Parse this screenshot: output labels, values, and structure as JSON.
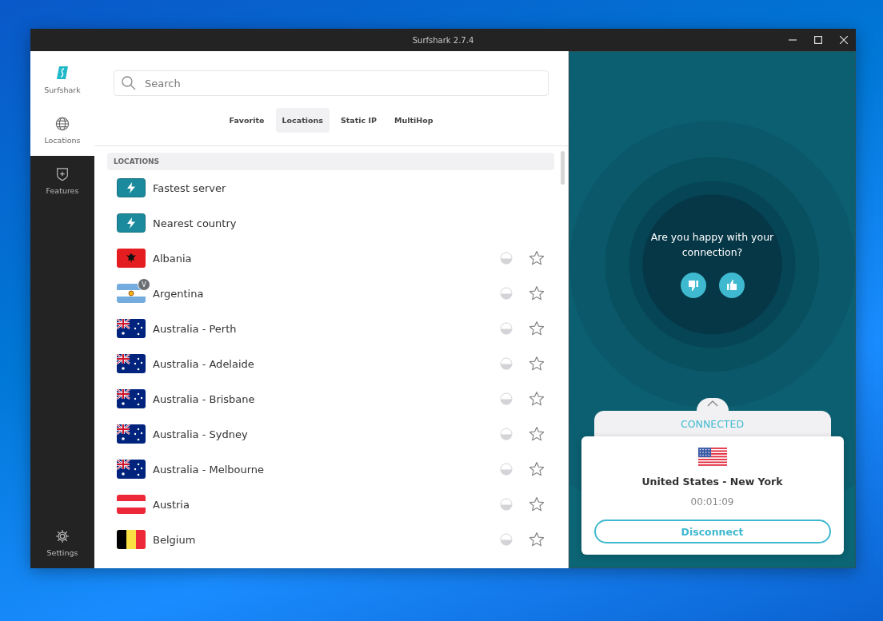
{
  "window": {
    "title": "Surfshark 2.7.4"
  },
  "sidebar": {
    "brand": "Surfshark",
    "items": [
      {
        "label": "Locations",
        "selected": true
      },
      {
        "label": "Features",
        "selected": false
      },
      {
        "label": "Settings",
        "selected": false
      }
    ]
  },
  "search": {
    "placeholder": "Search"
  },
  "tabs": [
    {
      "label": "Favorite",
      "selected": false
    },
    {
      "label": "Locations",
      "selected": true
    },
    {
      "label": "Static IP",
      "selected": false
    },
    {
      "label": "MultiHop",
      "selected": false
    }
  ],
  "section_header": "LOCATIONS",
  "locations": [
    {
      "name": "Fastest server",
      "kind": "quick"
    },
    {
      "name": "Nearest country",
      "kind": "quick"
    },
    {
      "name": "Albania",
      "kind": "country",
      "favorite": false
    },
    {
      "name": "Argentina",
      "kind": "country",
      "badge": "V",
      "favorite": false
    },
    {
      "name": "Australia - Perth",
      "kind": "country",
      "favorite": false
    },
    {
      "name": "Australia - Adelaide",
      "kind": "country",
      "favorite": false
    },
    {
      "name": "Australia - Brisbane",
      "kind": "country",
      "favorite": false
    },
    {
      "name": "Australia - Sydney",
      "kind": "country",
      "favorite": false
    },
    {
      "name": "Australia - Melbourne",
      "kind": "country",
      "favorite": false
    },
    {
      "name": "Austria",
      "kind": "country",
      "favorite": false
    },
    {
      "name": "Belgium",
      "kind": "country",
      "favorite": false
    }
  ],
  "feedback": {
    "question": "Are you happy with your connection?"
  },
  "connection": {
    "status": "CONNECTED",
    "location": "United States - New York",
    "duration": "00:01:09",
    "button": "Disconnect"
  }
}
